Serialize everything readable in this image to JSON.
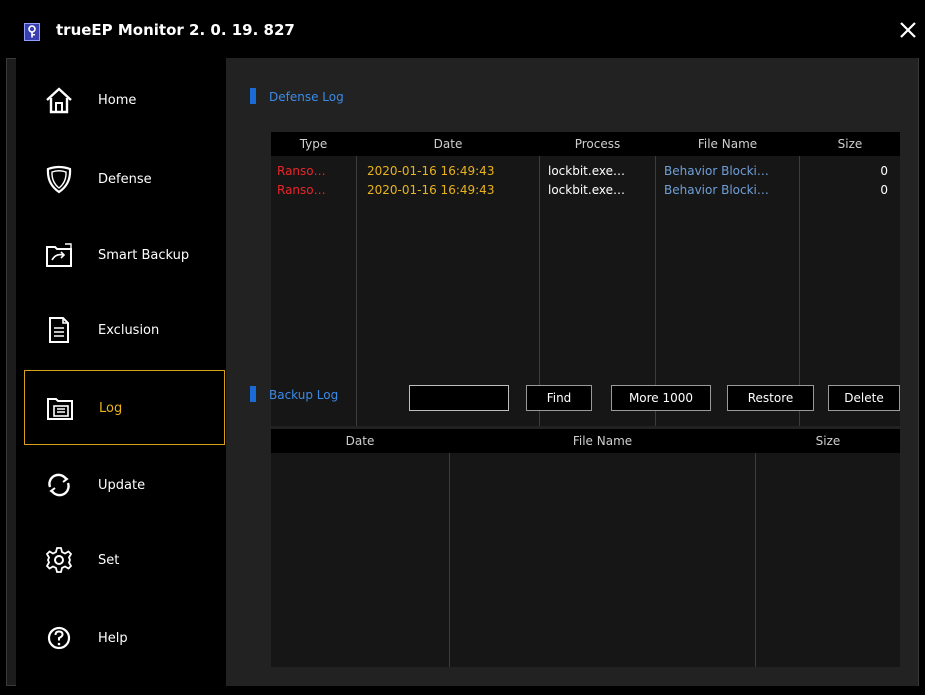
{
  "app": {
    "title": "trueEP Monitor 2. 0. 19. 827"
  },
  "sidebar": {
    "items": [
      {
        "label": "Home",
        "icon": "home-icon"
      },
      {
        "label": "Defense",
        "icon": "shield-icon"
      },
      {
        "label": "Smart Backup",
        "icon": "folder-backup-icon"
      },
      {
        "label": "Exclusion",
        "icon": "document-icon"
      },
      {
        "label": "Log",
        "icon": "log-folder-icon",
        "active": true
      },
      {
        "label": "Update",
        "icon": "update-icon"
      },
      {
        "label": "Set",
        "icon": "gear-icon"
      },
      {
        "label": "Help",
        "icon": "help-icon"
      }
    ]
  },
  "defense_log": {
    "title": "Defense Log",
    "columns": [
      "Type",
      "Date",
      "Process",
      "File Name",
      "Size"
    ],
    "rows": [
      {
        "type": "Ranso…",
        "date": "2020-01-16 16:49:43",
        "process": "lockbit.exe…",
        "file_name": "Behavior Blocki…",
        "size": "0"
      },
      {
        "type": "Ranso…",
        "date": "2020-01-16 16:49:43",
        "process": "lockbit.exe…",
        "file_name": "Behavior Blocki…",
        "size": "0"
      }
    ]
  },
  "backup_log": {
    "title": "Backup Log",
    "search_value": "",
    "buttons": {
      "find": "Find",
      "more": "More 1000",
      "restore": "Restore",
      "delete": "Delete"
    },
    "columns": [
      "Date",
      "File Name",
      "Size"
    ],
    "rows": []
  },
  "colors": {
    "accent_blue": "#1a6bd6",
    "active_gold": "#d7a11a",
    "type_red": "#e8262a",
    "date_gold": "#e8b31c",
    "file_blue": "#6f9fd8"
  }
}
